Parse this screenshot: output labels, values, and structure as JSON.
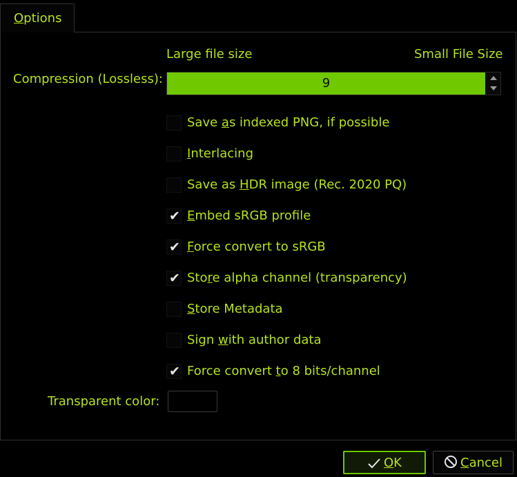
{
  "tab": {
    "label_pre": "",
    "label_key": "O",
    "label_post": "ptions",
    "label_full": "Options"
  },
  "compression": {
    "label": "Compression (Lossless):",
    "left_hint": "Large file size",
    "right_hint": "Small File Size",
    "value": "9",
    "level_fraction": 1.0
  },
  "checkboxes": [
    {
      "pre": "Save ",
      "key": "a",
      "post": "s indexed PNG, if possible",
      "checked": false
    },
    {
      "pre": "",
      "key": "I",
      "post": "nterlacing",
      "checked": false
    },
    {
      "pre": "Save as ",
      "key": "H",
      "post": "DR image (Rec. 2020 PQ)",
      "checked": false
    },
    {
      "pre": "",
      "key": "E",
      "post": "mbed sRGB profile",
      "checked": true
    },
    {
      "pre": "",
      "key": "F",
      "post": "orce convert to sRGB",
      "checked": true
    },
    {
      "pre": "Sto",
      "key": "r",
      "post": "e alpha channel (transparency)",
      "checked": true
    },
    {
      "pre": "",
      "key": "S",
      "post": "tore Metadata",
      "checked": false
    },
    {
      "pre": "Sign ",
      "key": "w",
      "post": "ith author data",
      "checked": false
    },
    {
      "pre": "Force convert ",
      "key": "t",
      "post": "o 8 bits/channel",
      "checked": true
    }
  ],
  "transparent_color": {
    "label": "Transparent color:"
  },
  "buttons": {
    "ok": {
      "pre": "",
      "key": "O",
      "post": "K",
      "icon": "check-icon"
    },
    "cancel": {
      "pre": "",
      "key": "C",
      "post": "ancel",
      "icon": "cancel-icon"
    }
  },
  "colors": {
    "text": "#b6e21c",
    "accent": "#6fc800",
    "background": "#000000"
  }
}
